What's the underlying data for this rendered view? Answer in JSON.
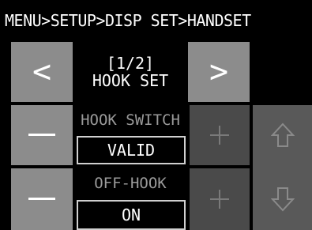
{
  "header": {
    "breadcrumb": "MENU>SETUP>DISP SET>HANDSET"
  },
  "page": {
    "indicator": "[1/2]",
    "title": "HOOK SET"
  },
  "nav": {
    "prev_glyph": "<",
    "next_glyph": ">"
  },
  "settings": [
    {
      "label": "HOOK SWITCH",
      "value": "VALID",
      "minus_glyph": "—",
      "plus_glyph": "+"
    },
    {
      "label": "OFF-HOOK",
      "value": "ON",
      "minus_glyph": "—",
      "plus_glyph": "+"
    }
  ],
  "scroll": {
    "up_icon": "arrow-up-outline-icon",
    "down_icon": "arrow-down-outline-icon"
  }
}
